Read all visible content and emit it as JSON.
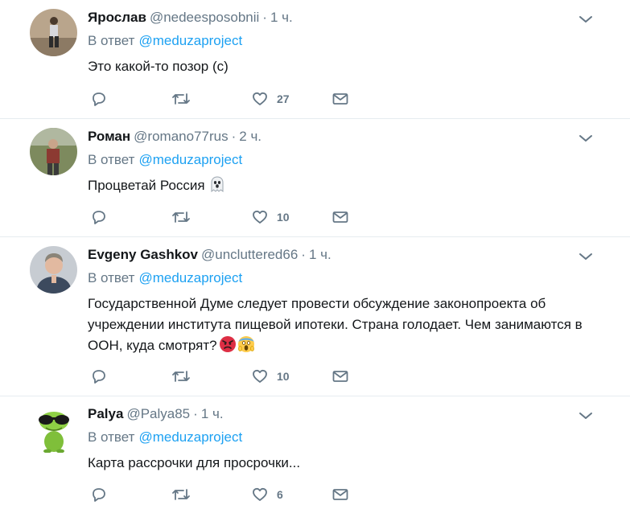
{
  "replies": [
    {
      "name": "Ярослав",
      "handle": "@nedeesposobnii",
      "separator": "·",
      "time": "1 ч.",
      "reply_prefix": "В ответ",
      "reply_to": "@meduzaproject",
      "text": "Это какой-то позор (с)",
      "likes": "27"
    },
    {
      "name": "Роман",
      "handle": "@romano77rus",
      "separator": "·",
      "time": "2 ч.",
      "reply_prefix": "В ответ",
      "reply_to": "@meduzaproject",
      "text": "Процветай Россия",
      "likes": "10"
    },
    {
      "name": "Evgeny Gashkov",
      "handle": "@uncluttered66",
      "separator": "·",
      "time": "1 ч.",
      "reply_prefix": "В ответ",
      "reply_to": "@meduzaproject",
      "text": "Государственной Думе следует провести обсуждение законопроекта об учреждении института пищевой ипотеки. Страна голодает. Чем занимаются в ООН, куда смотрят?",
      "likes": "10"
    },
    {
      "name": "Palya",
      "handle": "@Palya85",
      "separator": "·",
      "time": "1 ч.",
      "reply_prefix": "В ответ",
      "reply_to": "@meduzaproject",
      "text": "Карта рассрочки для просрочки...",
      "likes": "6"
    }
  ],
  "colors": {
    "text": "#14171a",
    "muted": "#657786",
    "link": "#1da1f2",
    "border": "#e6ecf0"
  },
  "icons": [
    "chevron-down-icon",
    "reply-icon",
    "retweet-icon",
    "like-icon",
    "message-icon",
    "ghost-emoji",
    "angry-face-emoji",
    "screaming-face-emoji"
  ]
}
